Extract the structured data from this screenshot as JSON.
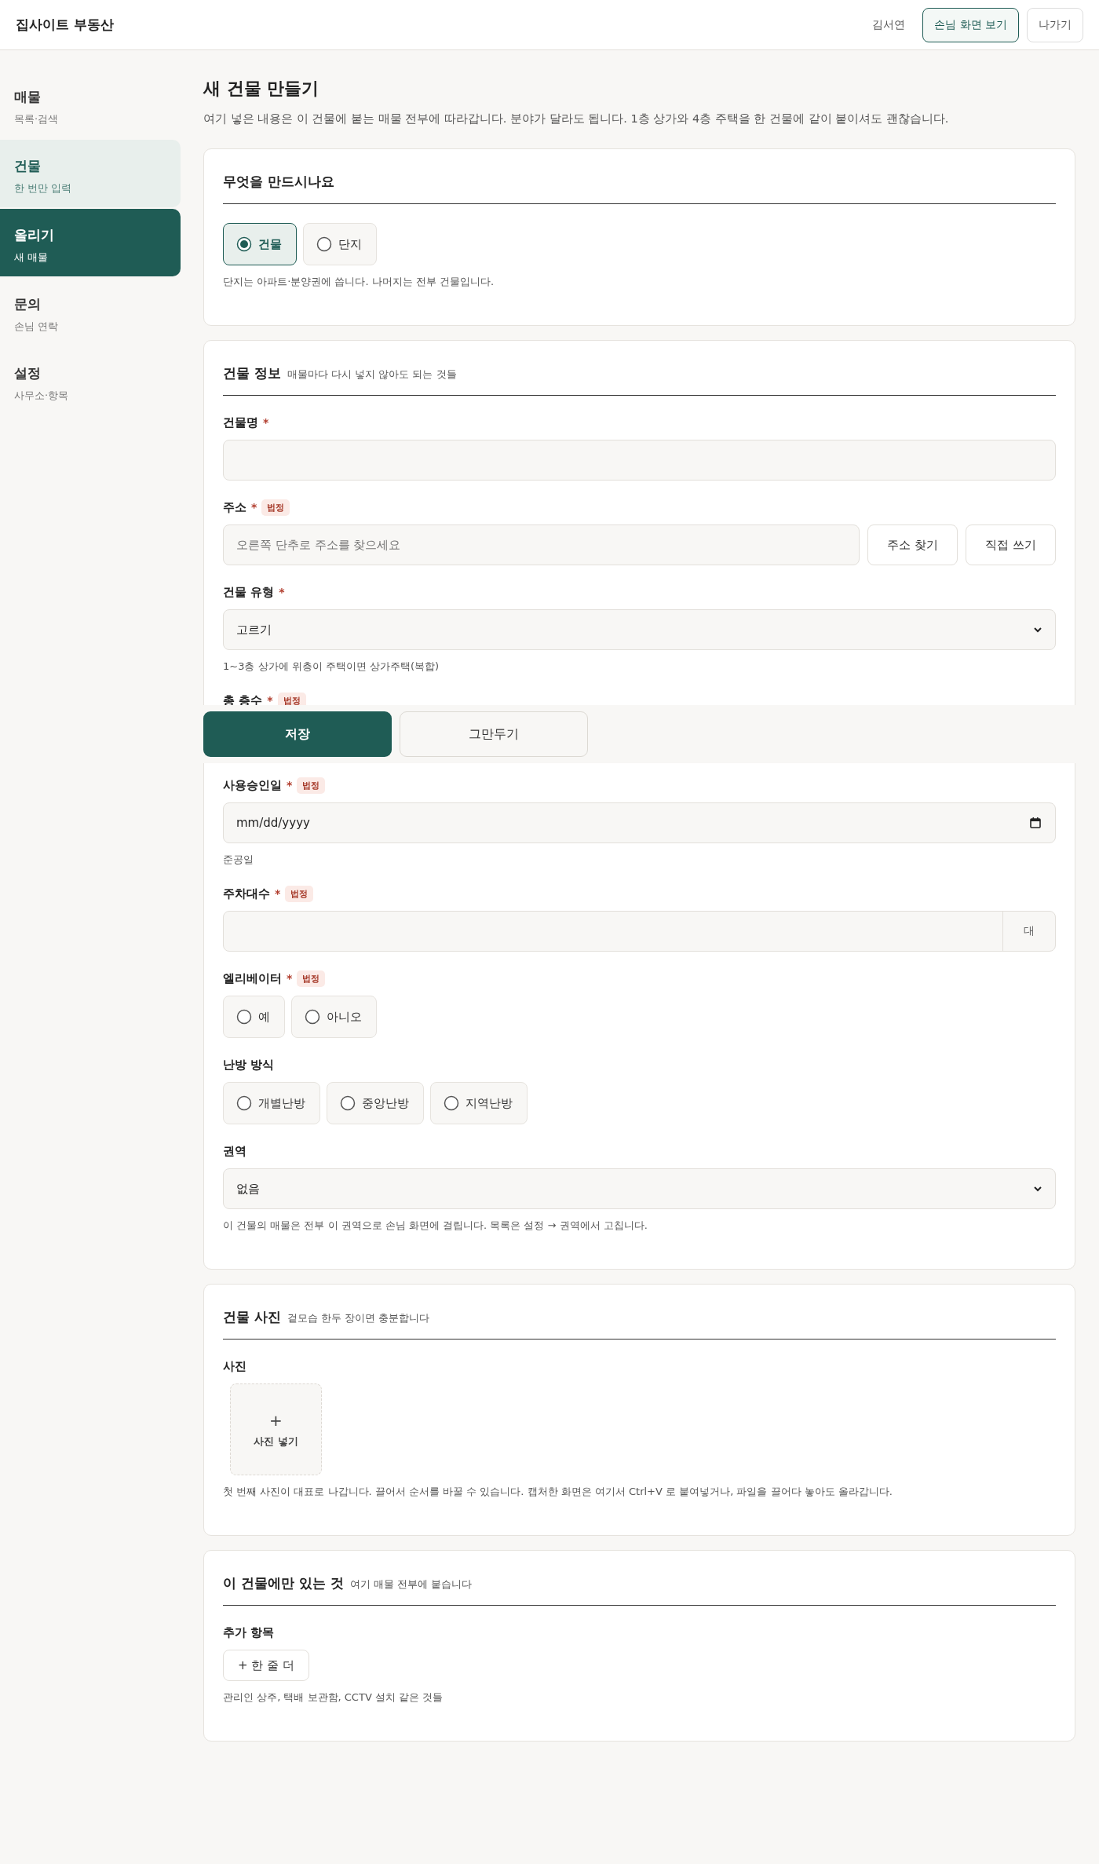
{
  "header": {
    "brand": "집사이트 부동산",
    "user": "김서연",
    "buttons": [
      {
        "label": "손님 화면 보기",
        "kind": "primary"
      },
      {
        "label": "나가기",
        "kind": "plain"
      }
    ]
  },
  "sidebar": {
    "items": [
      {
        "label": "매물",
        "sub": "목록·검색",
        "selected": false,
        "current": false
      },
      {
        "label": "건물",
        "sub": "한 번만 입력",
        "selected": false,
        "current": true
      },
      {
        "label": "올리기",
        "sub": "새 매물",
        "selected": true,
        "current": false
      },
      {
        "label": "문의",
        "sub": "손님 연락",
        "selected": false,
        "current": false
      },
      {
        "label": "설정",
        "sub": "사무소·항목",
        "selected": false,
        "current": false
      }
    ]
  },
  "page": {
    "title": "새 건물 만들기",
    "description": "여기 넣은 내용은 이 건물에 붙는 매물 전부에 따라갑니다. 분야가 달라도 됩니다. 1층 상가와 4층 주택을 한 건물에 같이 붙이셔도 괜찮습니다."
  },
  "sections": [
    {
      "title": "무엇을 만드시나요",
      "fields": [
        {
          "kind": "radio",
          "options": [
            {
              "label": "건물",
              "selected": true
            },
            {
              "label": "단지",
              "selected": false
            }
          ],
          "hint": "단지는 아파트·분양권에 씁니다. 나머지는 전부 건물입니다."
        }
      ]
    },
    {
      "title": "건물 정보",
      "subtitle": "매물마다 다시 넣지 않아도 되는 것들",
      "fields": [
        {
          "kind": "text",
          "label": "건물명",
          "mark": "*"
        },
        {
          "kind": "text",
          "label": "주소",
          "mark": "*",
          "badge": "법정",
          "placeholder": "오른쪽 단추로 주소를 찾으세요",
          "buttons": [
            "주소 찾기",
            "직접 쓰기"
          ]
        },
        {
          "kind": "select",
          "label": "건물 유형",
          "mark": "*",
          "value": "고르기",
          "hint": "1~3층 상가에 위층이 주택이면 상가주택(복합)"
        },
        {
          "kind": "covered",
          "label": "총 층수",
          "mark": "*",
          "badge": "법정"
        },
        {
          "kind": "date",
          "label": "사용승인일",
          "mark": "*",
          "badge": "법정",
          "placeholder": "mm/dd/yyyy",
          "hint": "준공일"
        },
        {
          "kind": "text",
          "label": "주차대수",
          "mark": "*",
          "badge": "법정",
          "unit": "대"
        },
        {
          "kind": "radio",
          "label": "엘리베이터",
          "mark": "*",
          "badge": "법정",
          "options": [
            {
              "label": "예",
              "selected": false
            },
            {
              "label": "아니오",
              "selected": false
            }
          ]
        },
        {
          "kind": "radio",
          "label": "난방 방식",
          "options": [
            {
              "label": "개별난방",
              "selected": false
            },
            {
              "label": "중앙난방",
              "selected": false
            },
            {
              "label": "지역난방",
              "selected": false
            }
          ]
        },
        {
          "kind": "select",
          "label": "권역",
          "value": "없음",
          "hint": "이 건물의 매물은 전부 이 권역으로 손님 화면에 걸립니다. 목록은 설정 → 권역에서 고칩니다."
        }
      ]
    },
    {
      "title": "건물 사진",
      "subtitle": "겉모습 한두 장이면 충분합니다",
      "fields": [
        {
          "kind": "upload",
          "label": "사진",
          "icon": "+",
          "button": "사진 넣기",
          "hint": "첫 번째 사진이 대표로 나갑니다. 끌어서 순서를 바꿀 수 있습니다. 캡처한 화면은 여기서 Ctrl+V 로 붙여넣거나, 파일을 끌어다 놓아도 올라갑니다."
        }
      ]
    },
    {
      "title": "이 건물에만 있는 것",
      "subtitle": "여기 매물 전부에 붙습니다",
      "fields": [
        {
          "kind": "add",
          "label": "추가 항목",
          "button": "+ 한 줄 더",
          "hint": "관리인 상주, 택배 보관함, CCTV 설치 같은 것들"
        }
      ]
    }
  ],
  "actions": [
    {
      "label": "저장",
      "kind": "primary"
    },
    {
      "label": "그만두기",
      "kind": "plain"
    }
  ]
}
